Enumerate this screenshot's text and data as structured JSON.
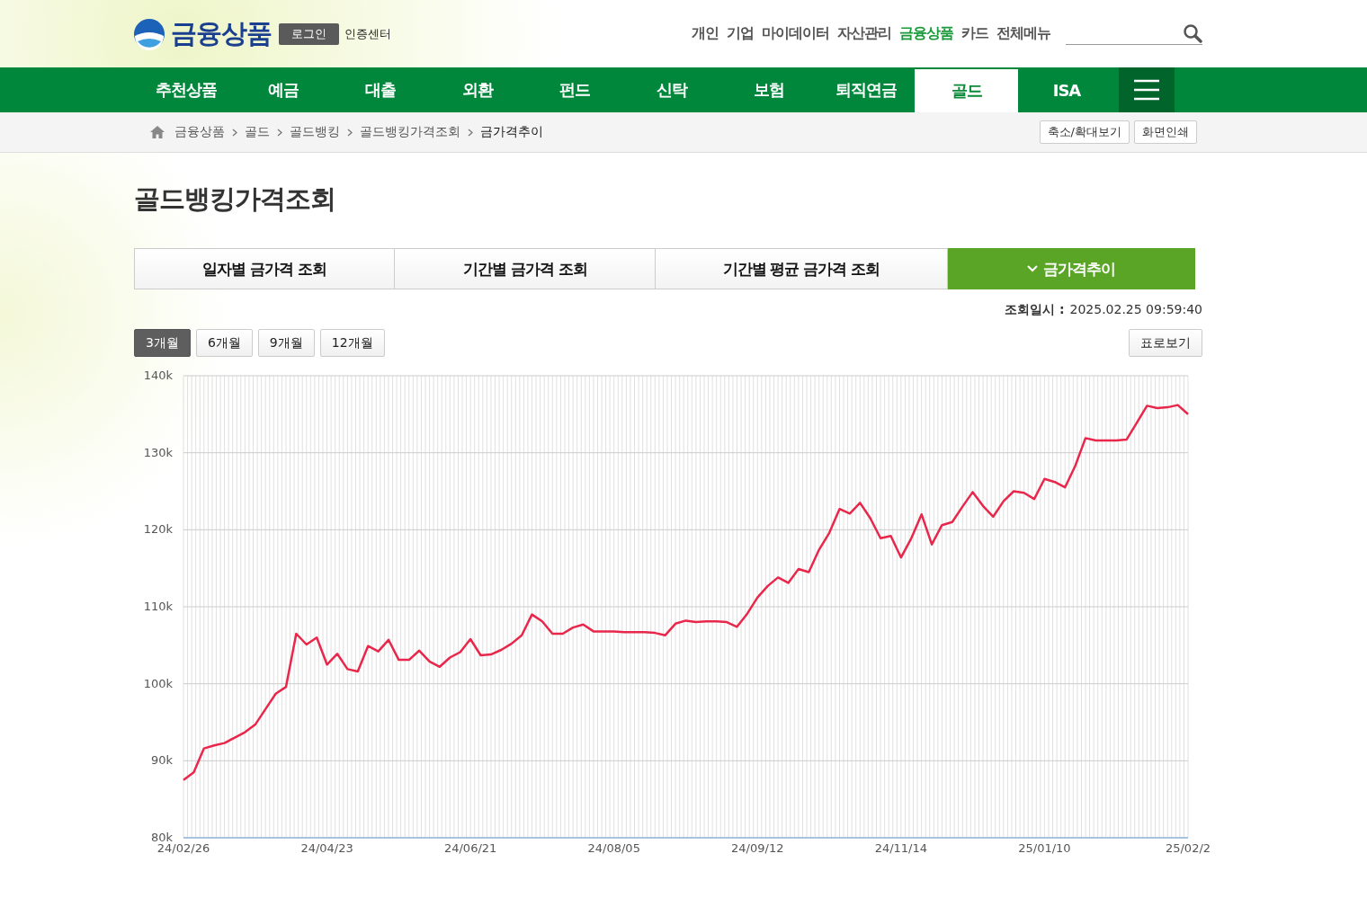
{
  "header": {
    "logo": "금융상품",
    "login_button": "로그인",
    "cert_link": "인증센터",
    "top_menu": [
      {
        "label": "개인",
        "selected": false
      },
      {
        "label": "기업",
        "selected": false
      },
      {
        "label": "마이데이터",
        "selected": false
      },
      {
        "label": "자산관리",
        "selected": false
      },
      {
        "label": "금융상품",
        "selected": true
      },
      {
        "label": "카드",
        "selected": false
      },
      {
        "label": "전체메뉴",
        "selected": false
      }
    ]
  },
  "nav": {
    "items": [
      {
        "label": "추천상품",
        "selected": false
      },
      {
        "label": "예금",
        "selected": false
      },
      {
        "label": "대출",
        "selected": false
      },
      {
        "label": "외환",
        "selected": false
      },
      {
        "label": "펀드",
        "selected": false
      },
      {
        "label": "신탁",
        "selected": false
      },
      {
        "label": "보험",
        "selected": false
      },
      {
        "label": "퇴직연금",
        "selected": false
      },
      {
        "label": "골드",
        "selected": true
      },
      {
        "label": "ISA",
        "selected": false
      }
    ]
  },
  "breadcrumb": {
    "items": [
      "금융상품",
      "골드",
      "골드뱅킹",
      "골드뱅킹가격조회",
      "금가격추이"
    ],
    "buttons": [
      "축소/확대보기",
      "화면인쇄"
    ]
  },
  "page_title": "골드뱅킹가격조회",
  "tabs": [
    {
      "label": "일자별 금가격 조회",
      "selected": false
    },
    {
      "label": "기간별 금가격 조회",
      "selected": false
    },
    {
      "label": "기간별 평균 금가격 조회",
      "selected": false
    },
    {
      "label": "금가격추이",
      "selected": true
    }
  ],
  "query_time": {
    "label": "조회일시 :",
    "value": "2025.02.25 09:59:40"
  },
  "periods": [
    {
      "label": "3개월",
      "selected": true
    },
    {
      "label": "6개월",
      "selected": false
    },
    {
      "label": "9개월",
      "selected": false
    },
    {
      "label": "12개월",
      "selected": false
    }
  ],
  "table_view_button": "표로보기",
  "chart_data": {
    "type": "line",
    "categories": [
      "24/02/26",
      null,
      null,
      null,
      null,
      null,
      null,
      null,
      null,
      null,
      null,
      null,
      null,
      null,
      "24/04/23",
      null,
      null,
      null,
      null,
      null,
      null,
      null,
      null,
      null,
      null,
      null,
      null,
      null,
      "24/06/21",
      null,
      null,
      null,
      null,
      null,
      null,
      null,
      null,
      null,
      null,
      null,
      null,
      null,
      "24/08/05",
      null,
      null,
      null,
      null,
      null,
      null,
      null,
      null,
      null,
      null,
      null,
      null,
      null,
      "24/09/12",
      null,
      null,
      null,
      null,
      null,
      null,
      null,
      null,
      null,
      null,
      null,
      null,
      null,
      "24/11/14",
      null,
      null,
      null,
      null,
      null,
      null,
      null,
      null,
      null,
      null,
      null,
      null,
      null,
      "25/01/10",
      null,
      null,
      null,
      null,
      null,
      null,
      null,
      null,
      null,
      null,
      null,
      null,
      null,
      "25/02/2"
    ],
    "series": [
      {
        "color": "#e8274b",
        "values": [
          87.5,
          88.5,
          91.6,
          92,
          92.3,
          93,
          93.7,
          94.7,
          96.7,
          98.7,
          99.6,
          106.5,
          105.1,
          106,
          102.5,
          103.9,
          101.9,
          101.6,
          104.9,
          104.2,
          105.7,
          103.1,
          103.1,
          104.3,
          102.9,
          102.2,
          103.4,
          104.1,
          105.8,
          103.7,
          103.8,
          104.4,
          105.2,
          106.3,
          109,
          108.1,
          106.5,
          106.5,
          107.3,
          107.7,
          106.8,
          106.8,
          106.8,
          106.7,
          106.7,
          106.7,
          106.6,
          106.3,
          107.8,
          108.2,
          108,
          108.1,
          108.1,
          108,
          107.4,
          109.1,
          111.2,
          112.7,
          113.8,
          113.1,
          114.9,
          114.5,
          117.4,
          119.6,
          122.7,
          122.1,
          123.5,
          121.5,
          118.9,
          119.2,
          116.4,
          118.9,
          122,
          118.1,
          120.6,
          121,
          123,
          124.9,
          123.1,
          121.7,
          123.7,
          125,
          124.8,
          124,
          126.6,
          126.2,
          125.5,
          128.3,
          131.9,
          131.6,
          131.6,
          131.6,
          131.7,
          133.9,
          136.1,
          135.8,
          135.9,
          136.2,
          135
        ]
      }
    ],
    "ylim": [
      80,
      140
    ],
    "grid": true,
    "yticks": [
      {
        "value": 80,
        "label": "80k"
      },
      {
        "value": 90,
        "label": "90k"
      },
      {
        "value": 100,
        "label": "100k"
      },
      {
        "value": 110,
        "label": "110k"
      },
      {
        "value": 120,
        "label": "120k"
      },
      {
        "value": 130,
        "label": "130k"
      },
      {
        "value": 140,
        "label": "140k"
      }
    ]
  }
}
